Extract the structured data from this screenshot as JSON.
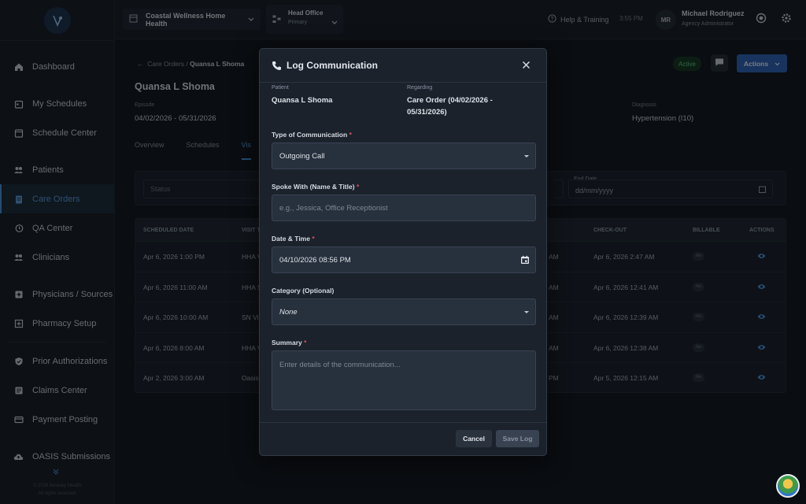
{
  "sidebar": {
    "items": [
      {
        "label": "Dashboard",
        "icon": "home-icon",
        "active": false
      },
      {
        "label": "My Schedules",
        "icon": "calendar-icon",
        "active": false
      },
      {
        "label": "Schedule Center",
        "icon": "calendar-grid-icon",
        "active": false
      },
      {
        "label": "Patients",
        "icon": "people-icon",
        "active": false
      },
      {
        "label": "Care Orders",
        "icon": "clipboard-icon",
        "active": true
      },
      {
        "label": "QA Center",
        "icon": "history-icon",
        "active": false
      },
      {
        "label": "Clinicians",
        "icon": "team-icon",
        "active": false
      },
      {
        "label": "Physicians / Sources",
        "icon": "medical-plus-icon",
        "active": false
      },
      {
        "label": "Pharmacy Setup",
        "icon": "pharmacy-icon",
        "active": false
      },
      {
        "label": "Prior Authorizations",
        "icon": "shield-check-icon",
        "active": false
      },
      {
        "label": "Claims Center",
        "icon": "claims-icon",
        "active": false
      },
      {
        "label": "Payment Posting",
        "icon": "payment-icon",
        "active": false
      },
      {
        "label": "OASIS Submissions",
        "icon": "cloud-upload-icon",
        "active": false
      }
    ],
    "footer_line1": "© 2026 Belasky Health",
    "footer_line2": "All rights reserved"
  },
  "topbar": {
    "agency": "Coastal Wellness Home Health",
    "office_name": "Head Office",
    "office_type": "Primary",
    "help": "Help & Training",
    "time": "3:55 PM",
    "avatar_initials": "MR",
    "user_name": "Michael Rodriguez",
    "user_role": "Agency Administrator"
  },
  "page": {
    "breadcrumb_parent": "Care Orders",
    "breadcrumb_sep": "/",
    "breadcrumb_current": "Quansa L Shoma",
    "patient_name": "Quansa L Shoma",
    "episode_label": "Episode",
    "episode_value": "04/02/2026 - 05/31/2026",
    "diagnosis_label": "Diagnosis",
    "diagnosis_value": "Hypertension (I10)",
    "status_badge": "Active",
    "actions_label": "Actions",
    "tabs": [
      "Overview",
      "Schedules",
      "Vis"
    ],
    "filter_status_placeholder": "Status",
    "filter_end_label": "End Date",
    "filter_end_placeholder": "dd/mm/yyyy"
  },
  "table": {
    "headers": [
      "SCHEDULED DATE",
      "VISIT T",
      "",
      "CHECK-OUT",
      "BILLABLE",
      "ACTIONS"
    ],
    "rows": [
      {
        "date": "Apr 6, 2026 1:00 PM",
        "visit": "HHA V",
        "checkin_tail": "AM",
        "checkout": "Apr 6, 2026 2:47 AM",
        "billable": "No"
      },
      {
        "date": "Apr 6, 2026 11:00 AM",
        "visit": "HHA S",
        "checkin_tail": "AM",
        "checkout": "Apr 6, 2026 12:41 AM",
        "billable": "No"
      },
      {
        "date": "Apr 6, 2026 10:00 AM",
        "visit": "SN Vi",
        "checkin_tail": "AM",
        "checkout": "Apr 6, 2026 12:39 AM",
        "billable": "No"
      },
      {
        "date": "Apr 6, 2026 8:00 AM",
        "visit": "HHA V",
        "checkin_tail": "AM",
        "checkout": "Apr 6, 2026 12:38 AM",
        "billable": "No"
      },
      {
        "date": "Apr 2, 2026 3:00 AM",
        "visit": "Oasis",
        "checkin_tail": "PM",
        "checkout": "Apr 5, 2026 12:15 AM",
        "billable": "No"
      }
    ]
  },
  "modal": {
    "title": "Log Communication",
    "patient_label": "Patient",
    "patient_value": "Quansa L Shoma",
    "regarding_label": "Regarding",
    "regarding_value": "Care Order (04/02/2026 - 05/31/2026)",
    "type_label": "Type of Communication",
    "type_value": "Outgoing Call",
    "spoke_label": "Spoke With (Name & Title)",
    "spoke_placeholder": "e.g., Jessica, Office Receptionist",
    "datetime_label": "Date & Time",
    "datetime_value": "04/10/2026 08:56 PM",
    "category_label": "Category (Optional)",
    "category_value": "None",
    "summary_label": "Summary",
    "summary_placeholder": "Enter details of the communication...",
    "required_mark": "*",
    "cancel_label": "Cancel",
    "save_label": "Save Log"
  },
  "colors": {
    "accent": "#4a90d6",
    "primary_button": "#2e62b4",
    "active_badge": "#5cc184",
    "required": "#e0525b"
  }
}
